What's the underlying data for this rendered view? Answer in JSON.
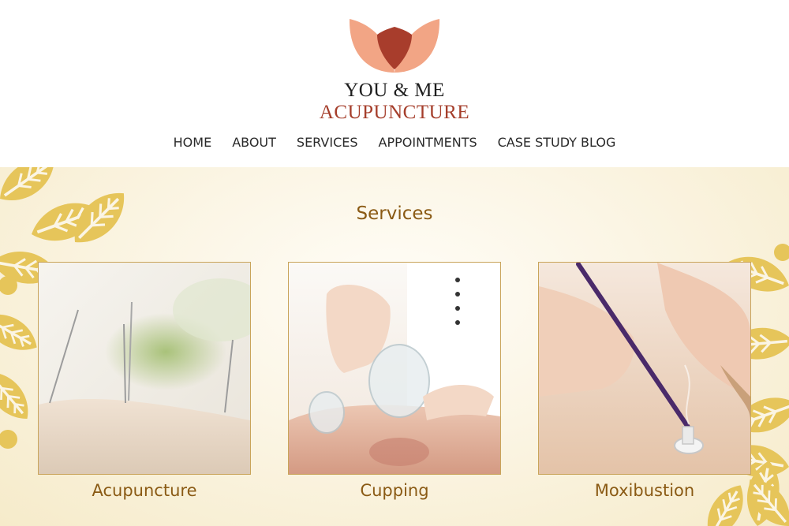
{
  "brand": {
    "line1": "YOU & ME",
    "line2": "ACUPUNCTURE",
    "colors": {
      "petal": "#f2a585",
      "center": "#a83d2c"
    }
  },
  "nav": {
    "items": [
      {
        "label": "HOME"
      },
      {
        "label": "ABOUT"
      },
      {
        "label": "SERVICES"
      },
      {
        "label": "APPOINTMENTS"
      },
      {
        "label": "CASE STUDY BLOG"
      }
    ]
  },
  "services": {
    "title": "Services",
    "items": [
      {
        "label": "Acupuncture"
      },
      {
        "label": "Cupping"
      },
      {
        "label": "Moxibustion"
      }
    ]
  },
  "colors": {
    "heading": "#8a5a14",
    "leaf": "#e6c55a",
    "card_border": "#c9a45a"
  }
}
